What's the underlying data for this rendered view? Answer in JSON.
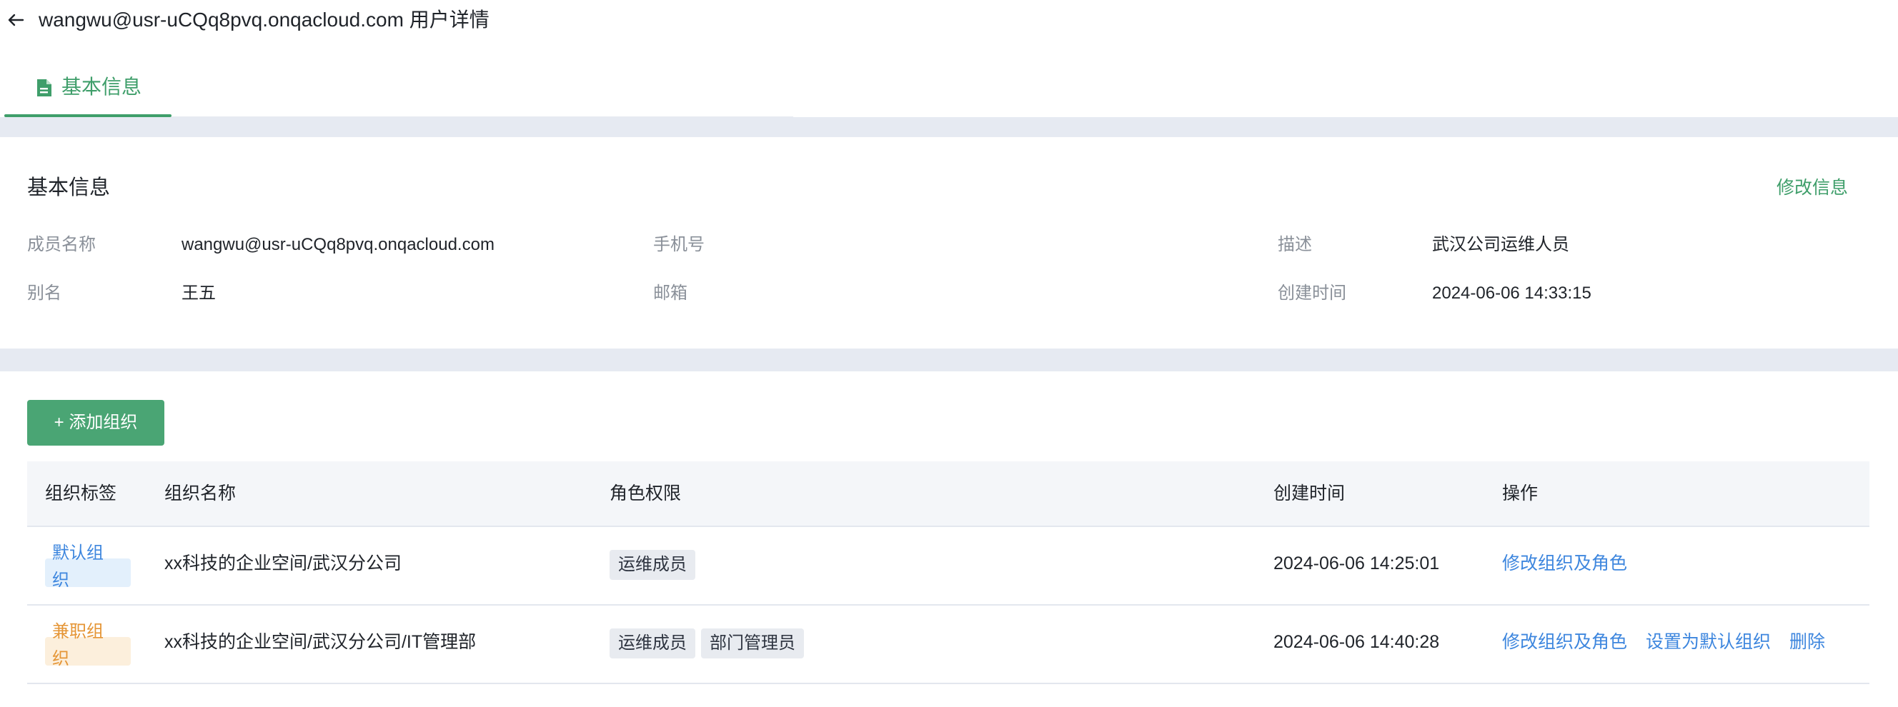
{
  "header": {
    "title": "wangwu@usr-uCQq8pvq.onqacloud.com 用户详情"
  },
  "tabs": [
    {
      "label": "基本信息",
      "active": true
    }
  ],
  "basic_info": {
    "section_title": "基本信息",
    "edit_link": "修改信息",
    "fields": {
      "member_name_label": "成员名称",
      "member_name_value": "wangwu@usr-uCQq8pvq.onqacloud.com",
      "phone_label": "手机号",
      "phone_value": "",
      "description_label": "描述",
      "description_value": "武汉公司运维人员",
      "alias_label": "别名",
      "alias_value": "王五",
      "email_label": "邮箱",
      "email_value": "",
      "created_label": "创建时间",
      "created_value": "2024-06-06 14:33:15"
    }
  },
  "orgs": {
    "add_button": "+ 添加组织",
    "columns": [
      "组织标签",
      "组织名称",
      "角色权限",
      "创建时间",
      "操作"
    ],
    "rows": [
      {
        "tag": "默认组织",
        "name": "xx科技的企业空间/武汉分公司",
        "roles": [
          "运维成员"
        ],
        "created": "2024-06-06 14:25:01",
        "actions": [
          "修改组织及角色"
        ]
      },
      {
        "tag": "兼职组织",
        "name": "xx科技的企业空间/武汉分公司/IT管理部",
        "roles": [
          "运维成员",
          "部门管理员"
        ],
        "created": "2024-06-06 14:40:28",
        "actions": [
          "修改组织及角色",
          "设置为默认组织",
          "删除"
        ]
      }
    ]
  },
  "colors": {
    "brand_green": "#3f9e6a",
    "button_green": "#4aa574",
    "link_blue": "#3d86de",
    "default_tag_text": "#3d86de",
    "default_tag_bg": "#e3f0fc",
    "part_tag_text": "#e59535",
    "part_tag_bg": "#fcefdc",
    "section_divider": "#e6eaf2"
  },
  "icons": {
    "back": "arrow-left-icon",
    "tab": "document-icon"
  }
}
